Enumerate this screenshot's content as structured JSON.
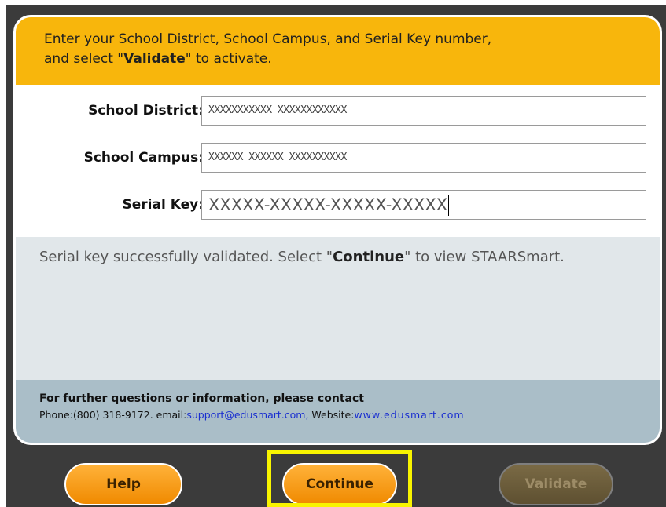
{
  "header": {
    "line1": "Enter your School District, School Campus, and Serial Key number,",
    "line2_prefix": "and select \"",
    "line2_bold": "Validate",
    "line2_suffix": "\" to activate."
  },
  "form": {
    "district_label": "School District:",
    "district_value": "XXXXXXXXXXX XXXXXXXXXXXX",
    "campus_label": "School Campus:",
    "campus_value": "XXXXXX XXXXXX XXXXXXXXXX",
    "serial_label": "Serial Key:",
    "serial_value": "XXXXX-XXXXX-XXXXX-XXXXX"
  },
  "message": {
    "prefix": "Serial key successfully validated. Select \"",
    "bold": "Continue",
    "suffix": "\" to view STAARSmart."
  },
  "contact": {
    "title": "For further questions or information, please contact",
    "phone": "Phone:(800) 318-9172.",
    "email_label": "email:",
    "email": "support@edusmart.com,",
    "website_label": "Website:",
    "website": "www.edusmart.com"
  },
  "buttons": {
    "help": "Help",
    "continue": "Continue",
    "validate": "Validate"
  },
  "colors": {
    "header_bg": "#f8b60c",
    "message_bg": "#e1e7ea",
    "contact_bg": "#aabec8",
    "button_orange": "#f39200",
    "highlight": "#f8f400",
    "frame": "#3b3b3b"
  }
}
